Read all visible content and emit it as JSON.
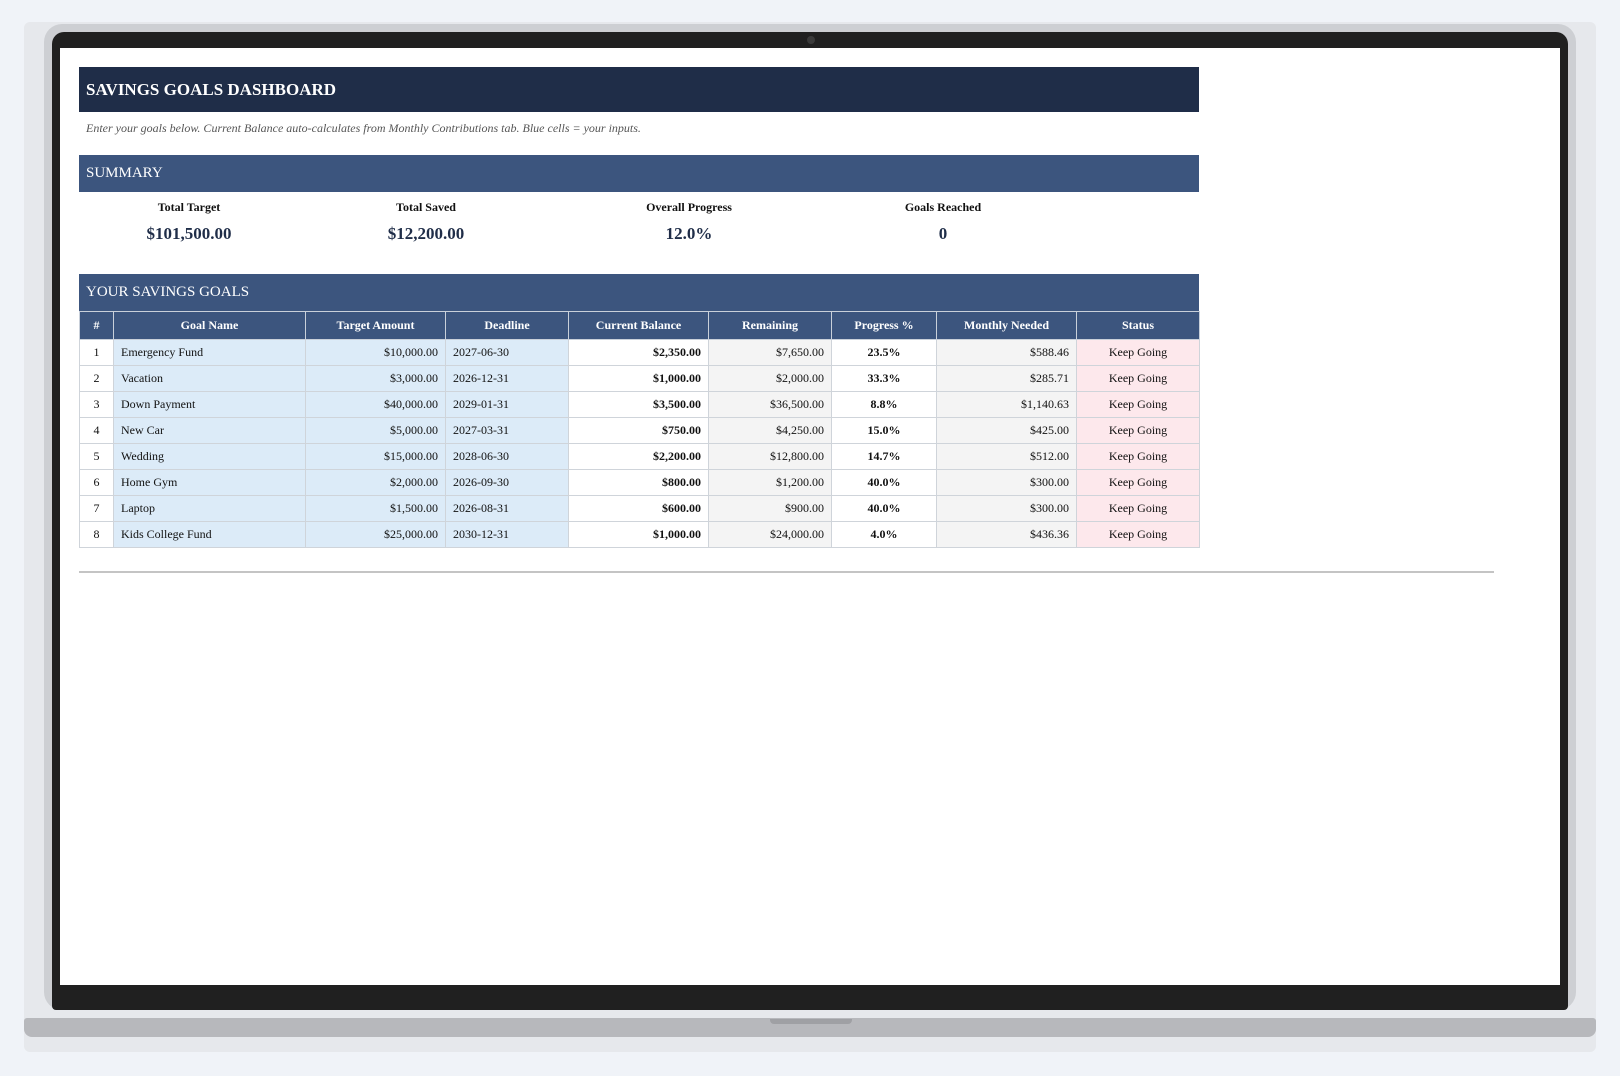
{
  "dashboard": {
    "title": "SAVINGS GOALS DASHBOARD",
    "note": "Enter your goals below. Current Balance auto-calculates from Monthly Contributions tab. Blue cells = your inputs."
  },
  "summary": {
    "header": "SUMMARY",
    "kpis": [
      {
        "label": "Total Target",
        "value": "$101,500.00"
      },
      {
        "label": "Total Saved",
        "value": "$12,200.00"
      },
      {
        "label": "Overall Progress",
        "value": "12.0%"
      },
      {
        "label": "Goals Reached",
        "value": "0"
      }
    ]
  },
  "goals": {
    "header": "YOUR SAVINGS GOALS",
    "columns": [
      "#",
      "Goal Name",
      "Target Amount",
      "Deadline",
      "Current Balance",
      "Remaining",
      "Progress %",
      "Monthly Needed",
      "Status"
    ],
    "rows": [
      {
        "num": "1",
        "name": "Emergency Fund",
        "target": "$10,000.00",
        "deadline": "2027-06-30",
        "balance": "$2,350.00",
        "remaining": "$7,650.00",
        "progress": "23.5%",
        "monthly": "$588.46",
        "status": "Keep Going"
      },
      {
        "num": "2",
        "name": "Vacation",
        "target": "$3,000.00",
        "deadline": "2026-12-31",
        "balance": "$1,000.00",
        "remaining": "$2,000.00",
        "progress": "33.3%",
        "monthly": "$285.71",
        "status": "Keep Going"
      },
      {
        "num": "3",
        "name": "Down Payment",
        "target": "$40,000.00",
        "deadline": "2029-01-31",
        "balance": "$3,500.00",
        "remaining": "$36,500.00",
        "progress": "8.8%",
        "monthly": "$1,140.63",
        "status": "Keep Going"
      },
      {
        "num": "4",
        "name": "New Car",
        "target": "$5,000.00",
        "deadline": "2027-03-31",
        "balance": "$750.00",
        "remaining": "$4,250.00",
        "progress": "15.0%",
        "monthly": "$425.00",
        "status": "Keep Going"
      },
      {
        "num": "5",
        "name": "Wedding",
        "target": "$15,000.00",
        "deadline": "2028-06-30",
        "balance": "$2,200.00",
        "remaining": "$12,800.00",
        "progress": "14.7%",
        "monthly": "$512.00",
        "status": "Keep Going"
      },
      {
        "num": "6",
        "name": "Home Gym",
        "target": "$2,000.00",
        "deadline": "2026-09-30",
        "balance": "$800.00",
        "remaining": "$1,200.00",
        "progress": "40.0%",
        "monthly": "$300.00",
        "status": "Keep Going"
      },
      {
        "num": "7",
        "name": "Laptop",
        "target": "$1,500.00",
        "deadline": "2026-08-31",
        "balance": "$600.00",
        "remaining": "$900.00",
        "progress": "40.0%",
        "monthly": "$300.00",
        "status": "Keep Going"
      },
      {
        "num": "8",
        "name": "Kids College Fund",
        "target": "$25,000.00",
        "deadline": "2030-12-31",
        "balance": "$1,000.00",
        "remaining": "$24,000.00",
        "progress": "4.0%",
        "monthly": "$436.36",
        "status": "Keep Going"
      }
    ]
  },
  "colors": {
    "title_bg": "#1f2d48",
    "section_bg": "#3c557e",
    "input_cell": "#dcebf8",
    "status_cell": "#fde8ec"
  }
}
